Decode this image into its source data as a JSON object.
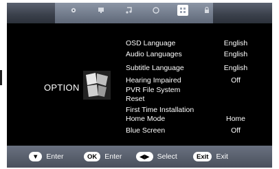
{
  "tabs": [
    {
      "icon": "gear-icon"
    },
    {
      "icon": "monitor-icon"
    },
    {
      "icon": "music-note-icon"
    },
    {
      "icon": "clock-icon"
    },
    {
      "icon": "grid-option-icon"
    },
    {
      "icon": "lock-icon"
    }
  ],
  "page": {
    "title": "OPTION"
  },
  "menu": [
    {
      "label": "OSD Language",
      "value": "English"
    },
    {
      "label": "Audio Languages",
      "value": "English"
    },
    {
      "label": "Subtitle Language",
      "value": "English"
    },
    {
      "label": "Hearing Impaired",
      "value": "Off"
    },
    {
      "label": "PVR File System",
      "value": ""
    },
    {
      "label": "Reset",
      "value": ""
    },
    {
      "label": "First Time Installation",
      "value": ""
    },
    {
      "label": "Home Mode",
      "value": "Home"
    },
    {
      "label": "Blue Screen",
      "value": "Off"
    }
  ],
  "footer": {
    "enter1": {
      "key": "▼",
      "label": "Enter"
    },
    "enter2": {
      "key": "OK",
      "label": "Enter"
    },
    "select": {
      "key": "◀▶",
      "label": "Select"
    },
    "exit": {
      "key": "Exit",
      "label": "Exit"
    }
  }
}
